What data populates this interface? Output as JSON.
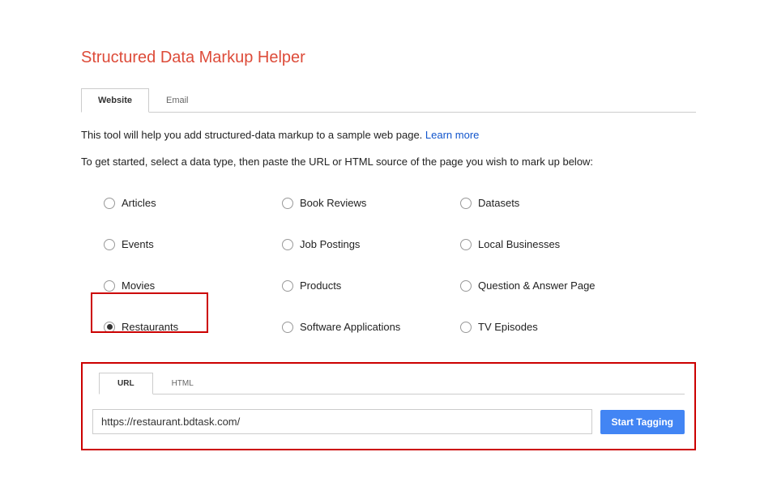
{
  "title": "Structured Data Markup Helper",
  "tabs": {
    "website": "Website",
    "email": "Email"
  },
  "intro": "This tool will help you add structured-data markup to a sample web page. ",
  "learn_more": "Learn more",
  "instruction": "To get started, select a data type, then paste the URL or HTML source of the page you wish to mark up below:",
  "options": {
    "articles": "Articles",
    "book_reviews": "Book Reviews",
    "datasets": "Datasets",
    "events": "Events",
    "job_postings": "Job Postings",
    "local_businesses": "Local Businesses",
    "movies": "Movies",
    "products": "Products",
    "qa_page": "Question & Answer Page",
    "restaurants": "Restaurants",
    "software_apps": "Software Applications",
    "tv_episodes": "TV Episodes"
  },
  "input_tabs": {
    "url": "URL",
    "html": "HTML"
  },
  "url_value": "https://restaurant.bdtask.com/",
  "start_button": "Start Tagging"
}
